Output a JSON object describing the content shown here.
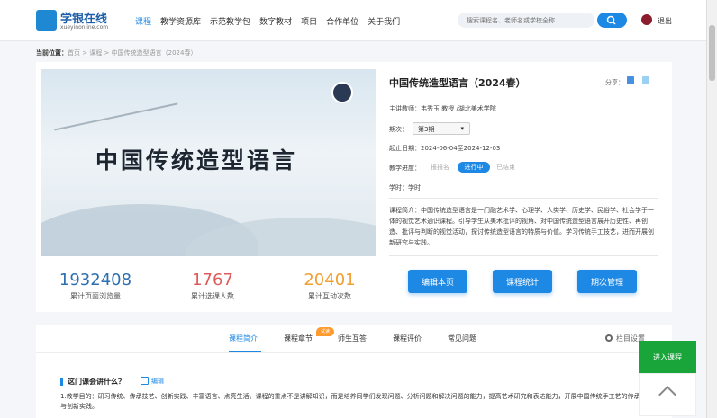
{
  "header": {
    "logo_cn": "学银在线",
    "logo_en": "xueyinonline.com",
    "nav": [
      "课程",
      "教学资源库",
      "示范教学包",
      "数字教材",
      "项目",
      "合作单位",
      "关于我们"
    ],
    "search_placeholder": "搜索课程名、老师名或学校全称",
    "logout": "退出"
  },
  "breadcrumb": {
    "label": "当前位置：",
    "path": "首页 > 课程 > 中国传统造型语言（2024春）"
  },
  "banner": {
    "title": "中国传统造型语言"
  },
  "stats": [
    {
      "value": "1932408",
      "label": "累计页面浏览量",
      "color": "#2e6fb0"
    },
    {
      "value": "1767",
      "label": "累计选课人数",
      "color": "#e05a5a"
    },
    {
      "value": "20401",
      "label": "累计互动次数",
      "color": "#f0a030"
    }
  ],
  "course": {
    "title": "中国传统造型语言（2024春）",
    "share": "分享：",
    "teacher": "主讲教师：韦秀玉 教授 /湖北美术学院",
    "term_label": "期次：",
    "term_value": "第3期",
    "date": "起止日期：2024-06-04至2024-12-03",
    "progress_label": "教学进度：",
    "progress_before": "报报名",
    "progress_current": "进行中",
    "progress_after": "已结束",
    "hours": "学时：学时",
    "intro": "课程简介：中国传统造型语言是一门融艺术学、心理学、人类学、历史学、民俗学、社会学于一体的视觉艺术通识课程。引导学生从美术批评的视角、对中国传统造型语言展开历史性、再创造、批评与判断的视觉活动，探讨传统造型语言的特质与价值。学习传统手工技艺，进而开展创新研究与实践。"
  },
  "buttons": {
    "edit": "编辑本页",
    "stats": "课程统计",
    "term": "期次管理"
  },
  "tabs": {
    "items": [
      "课程简介",
      "课程章节",
      "师生互答",
      "课程评价",
      "常见问题"
    ],
    "badge": "试读",
    "settings": "栏目设置"
  },
  "section": {
    "title": "这门课会讲什么？",
    "edit": "编辑",
    "body": "1.教学目的：研习传统、传承技艺、创新实践、丰富语言、点亮生活。课程的重点不是讲解知识，而是培养同学们发现问题、分析问题和解决问题的能力，提高艺术研究和表达能力，开展中国传统手工艺的传承与创新实践。"
  },
  "floating": {
    "enroll": "进入课程"
  }
}
